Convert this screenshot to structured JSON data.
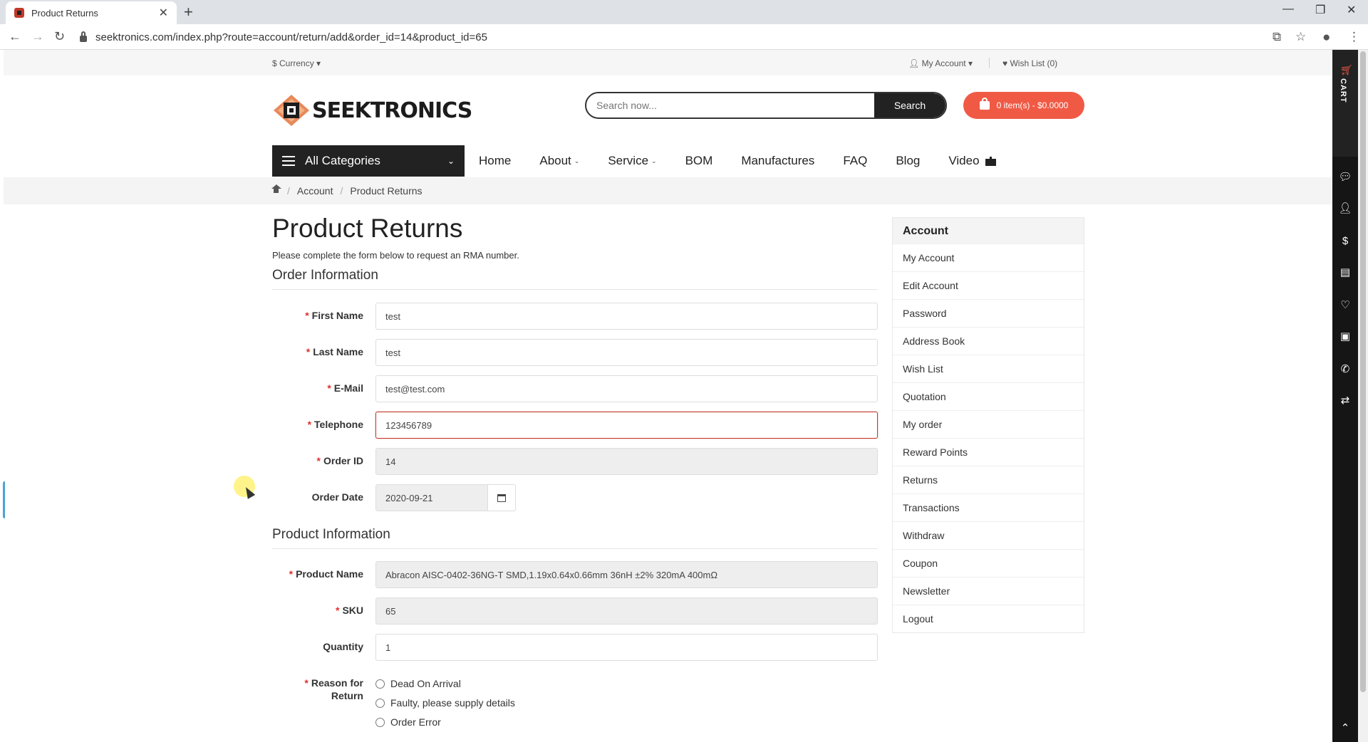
{
  "browser": {
    "tab_title": "Product Returns",
    "url": "seektronics.com/index.php?route=account/return/add&order_id=14&product_id=65"
  },
  "topbar": {
    "currency": "$ Currency",
    "my_account": "My Account",
    "wish_list": "Wish List (0)"
  },
  "header": {
    "logo_text": "SEEKTRONICS",
    "search_placeholder": "Search now...",
    "search_button": "Search",
    "cart": "0 item(s) - $0.0000"
  },
  "nav": {
    "all_categories": "All Categories",
    "items": [
      "Home",
      "About",
      "Service",
      "BOM",
      "Manufactures",
      "FAQ",
      "Blog",
      "Video"
    ]
  },
  "breadcrumb": [
    "Account",
    "Product Returns"
  ],
  "page": {
    "title": "Product Returns",
    "intro": "Please complete the form below to request an RMA number.",
    "order_section": "Order Information",
    "product_section": "Product Information"
  },
  "order_fields": {
    "first_name": {
      "label": "First Name",
      "value": "test"
    },
    "last_name": {
      "label": "Last Name",
      "value": "test"
    },
    "email": {
      "label": "E-Mail",
      "value": "test@test.com"
    },
    "telephone": {
      "label": "Telephone",
      "value": "123456789"
    },
    "order_id": {
      "label": "Order ID",
      "value": "14"
    },
    "order_date": {
      "label": "Order Date",
      "value": "2020-09-21"
    }
  },
  "product_fields": {
    "product_name": {
      "label": "Product Name",
      "value": "Abracon AISC-0402-36NG-T SMD,1.19x0.64x0.66mm 36nH ±2% 320mA 400mΩ"
    },
    "sku": {
      "label": "SKU",
      "value": "65"
    },
    "quantity": {
      "label": "Quantity",
      "value": "1"
    },
    "reason": {
      "label_line1": "Reason for",
      "label_line2": "Return",
      "options": [
        "Dead On Arrival",
        "Faulty, please supply details",
        "Order Error"
      ]
    }
  },
  "sidebar": {
    "heading": "Account",
    "items": [
      "My Account",
      "Edit Account",
      "Password",
      "Address Book",
      "Wish List",
      "Quotation",
      "My order",
      "Reward Points",
      "Returns",
      "Transactions",
      "Withdraw",
      "Coupon",
      "Newsletter",
      "Logout"
    ]
  },
  "right_toolbar": {
    "cart_label": "CART"
  },
  "colors": {
    "accent": "#f05a45",
    "required": "#e3302b",
    "dark": "#222222"
  }
}
